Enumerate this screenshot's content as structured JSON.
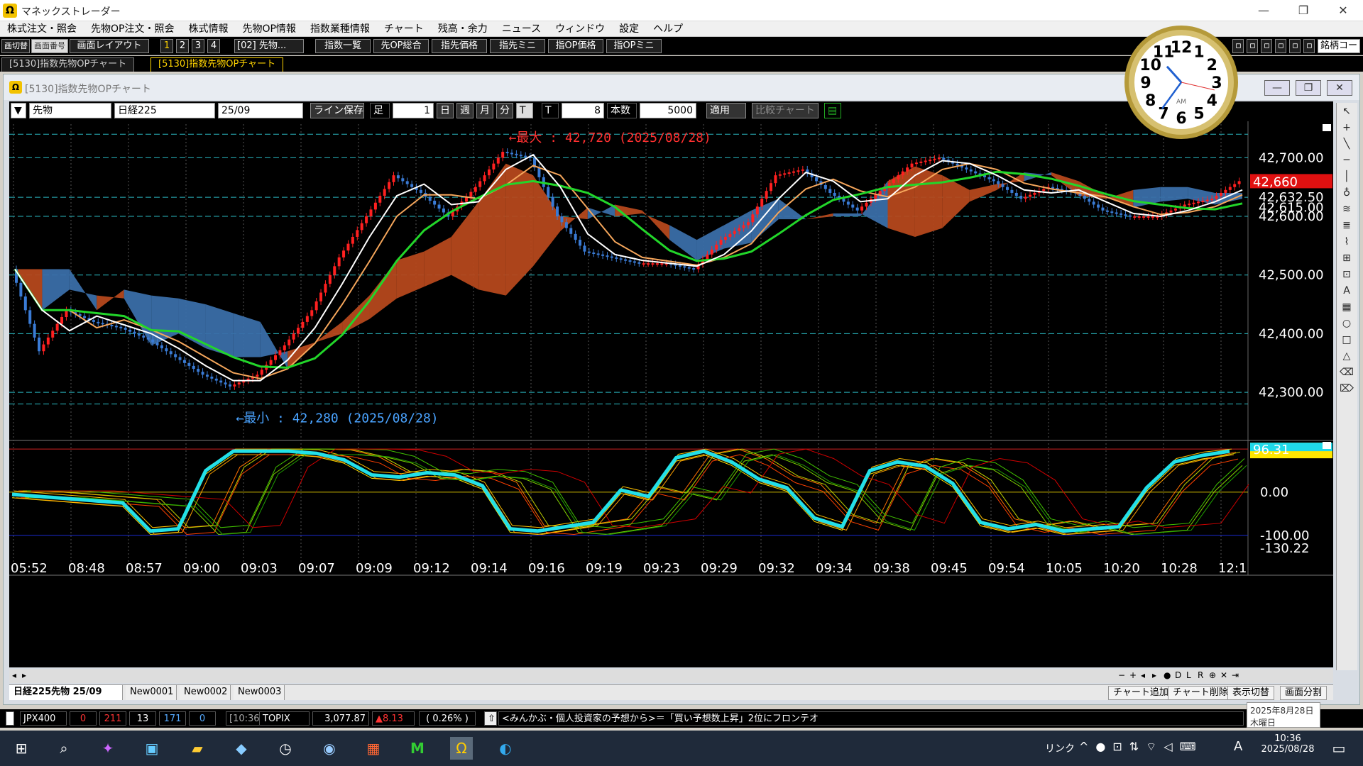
{
  "app": {
    "title": "マネックストレーダー",
    "icon_label": "Ω"
  },
  "window_controls": [
    "—",
    "❐",
    "✕"
  ],
  "menu": [
    "株式注文・照会",
    "先物OP注文・照会",
    "株式情報",
    "先物OP情報",
    "指数業種情報",
    "チャート",
    "残高・余力",
    "ニュース",
    "ウィンドウ",
    "設定",
    "ヘルプ"
  ],
  "toolbar": {
    "left1": "画切替",
    "left2": "画面番号",
    "layout": "画面レイアウト",
    "nums": [
      "1",
      "2",
      "3",
      "4"
    ],
    "screen": "[02] 先物...",
    "buttons": [
      "指数一覧",
      "先OP総合",
      "指先価格",
      "指先ミニ",
      "指OP価格",
      "指OPミニ"
    ],
    "right": "銘柄コード"
  },
  "main_tabs": [
    "[5130]指数先物OPチャート",
    "[5130]指数先物OPチャート"
  ],
  "child": {
    "title": "[5130]指数先物OPチャート",
    "controls": [
      "—",
      "❐",
      "✕"
    ]
  },
  "chart_toolbar": {
    "type": "先物",
    "index": "日経225",
    "month": "25/09",
    "save": "ライン保存",
    "foot": "足",
    "foot_val": "1",
    "periods": [
      "日",
      "週",
      "月",
      "分",
      "T"
    ],
    "t_label": "T",
    "t_val": "8",
    "count_label": "本数",
    "count_val": "5000",
    "apply": "適用",
    "compare": "比較チャート"
  },
  "price_labels": [
    "42,700.00",
    "42,632.50",
    "42,615.00",
    "42,600.00",
    "42,500.00",
    "42,400.00",
    "42,300.00"
  ],
  "current_price": "42,660",
  "max_label": "←最大 : 42,720 (2025/08/28)",
  "min_label": "←最小 : 42,280 (2025/08/28)",
  "osc_labels": [
    "0.00",
    "-100.00",
    "-130.22"
  ],
  "osc_current": "96.31",
  "time_labels": [
    "05:52",
    "08:48",
    "08:57",
    "09:00",
    "09:03",
    "09:07",
    "09:09",
    "09:12",
    "09:14",
    "09:16",
    "09:19",
    "09:23",
    "09:29",
    "09:32",
    "09:34",
    "09:38",
    "09:45",
    "09:54",
    "10:05",
    "10:20",
    "10:28",
    "12:1"
  ],
  "colors": {
    "up": "#ff2020",
    "down": "#3a7bd5",
    "kumo_up": "#b5481c",
    "kumo_down": "#3a6ea8",
    "ma_white": "#ffffff",
    "ma_orange": "#f5a65b",
    "ma_green": "#22d62a",
    "osc": "#22e0e8",
    "hline": "#2ab7c0"
  },
  "chart_data": {
    "type": "line",
    "title": "日経225 先物 25/09",
    "ylim": [
      42230,
      42750
    ],
    "max": 42720,
    "min": 42280,
    "current": 42660,
    "series": [
      {
        "name": "price",
        "values": [
          42510,
          42370,
          42440,
          42420,
          42410,
          42390,
          42360,
          42330,
          42310,
          42330,
          42380,
          42440,
          42530,
          42600,
          42670,
          42640,
          42600,
          42650,
          42710,
          42700,
          42600,
          42540,
          42530,
          42520,
          42520,
          42510,
          42560,
          42590,
          42670,
          42680,
          42640,
          42610,
          42650,
          42690,
          42700,
          42680,
          42660,
          42630,
          42650,
          42640,
          42610,
          42600,
          42600,
          42620,
          42630,
          42660
        ]
      }
    ],
    "oscillator": {
      "ylim": [
        -130,
        110
      ],
      "values": [
        -5,
        -10,
        -15,
        -20,
        -25,
        -90,
        -85,
        50,
        95,
        95,
        95,
        90,
        75,
        40,
        35,
        45,
        40,
        15,
        -85,
        -90,
        -80,
        -70,
        5,
        -10,
        80,
        95,
        70,
        30,
        10,
        -60,
        -80,
        50,
        70,
        60,
        20,
        -70,
        -85,
        -75,
        -90,
        -85,
        -80,
        10,
        70,
        85,
        95
      ]
    },
    "kumo_side": "right"
  },
  "clock": {
    "time": "10:36",
    "numbers": [
      "12",
      "1",
      "2",
      "3",
      "4",
      "5",
      "6",
      "7",
      "8",
      "9",
      "10",
      "11"
    ],
    "ampm": "AM"
  },
  "sheets": [
    "日経225先物 25/09",
    "New0001",
    "New0002",
    "New0003"
  ],
  "bottom_buttons": [
    "チャート追加",
    "チャート削除",
    "表示切替",
    "画面分割"
  ],
  "statusbar": {
    "code": "JPX400",
    "v1": "0",
    "v2": "211",
    "v3": "13",
    "v4": "171",
    "v5": "0",
    "time": "[10:36]",
    "index": "TOPIX",
    "value": "3,077.87",
    "change": "▲8.13",
    "pct": "( 0.26% )",
    "news": "<みんかぶ・個人投資家の予想から>＝「買い予想数上昇」2位にフロンテオ",
    "date_tip": "2025年8月28日",
    "weekday": "木曜日"
  },
  "taskbar": {
    "lang": "リンク",
    "ime": "A",
    "time": "10:36",
    "date": "2025/08/28"
  }
}
